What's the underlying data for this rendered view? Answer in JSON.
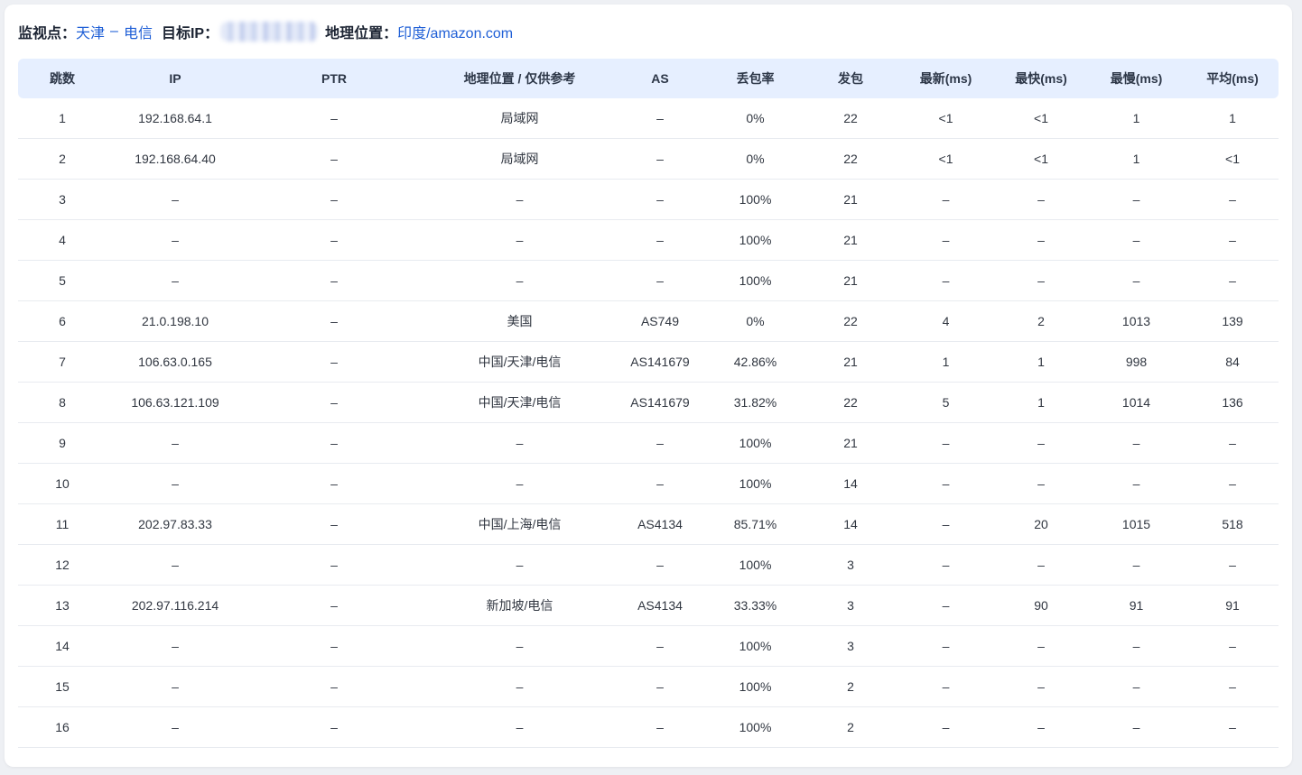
{
  "header": {
    "monitor_label": "监视点：",
    "monitor_city": "天津",
    "monitor_sep": "–",
    "monitor_isp": "电信",
    "target_label": "目标IP：",
    "geo_label": "地理位置：",
    "geo_value": "印度/amazon.com"
  },
  "colors": {
    "accent": "#1f5fd6",
    "header_bg": "#e6efff",
    "page_bg": "#eef0f4"
  },
  "table": {
    "columns": [
      "跳数",
      "IP",
      "PTR",
      "地理位置 / 仅供参考",
      "AS",
      "丢包率",
      "发包",
      "最新(ms)",
      "最快(ms)",
      "最慢(ms)",
      "平均(ms)"
    ],
    "rows": [
      [
        "1",
        "192.168.64.1",
        "–",
        "局域网",
        "–",
        "0%",
        "22",
        "<1",
        "<1",
        "1",
        "1"
      ],
      [
        "2",
        "192.168.64.40",
        "–",
        "局域网",
        "–",
        "0%",
        "22",
        "<1",
        "<1",
        "1",
        "<1"
      ],
      [
        "3",
        "–",
        "–",
        "–",
        "–",
        "100%",
        "21",
        "–",
        "–",
        "–",
        "–"
      ],
      [
        "4",
        "–",
        "–",
        "–",
        "–",
        "100%",
        "21",
        "–",
        "–",
        "–",
        "–"
      ],
      [
        "5",
        "–",
        "–",
        "–",
        "–",
        "100%",
        "21",
        "–",
        "–",
        "–",
        "–"
      ],
      [
        "6",
        "21.0.198.10",
        "–",
        "美国",
        "AS749",
        "0%",
        "22",
        "4",
        "2",
        "1013",
        "139"
      ],
      [
        "7",
        "106.63.0.165",
        "–",
        "中国/天津/电信",
        "AS141679",
        "42.86%",
        "21",
        "1",
        "1",
        "998",
        "84"
      ],
      [
        "8",
        "106.63.121.109",
        "–",
        "中国/天津/电信",
        "AS141679",
        "31.82%",
        "22",
        "5",
        "1",
        "1014",
        "136"
      ],
      [
        "9",
        "–",
        "–",
        "–",
        "–",
        "100%",
        "21",
        "–",
        "–",
        "–",
        "–"
      ],
      [
        "10",
        "–",
        "–",
        "–",
        "–",
        "100%",
        "14",
        "–",
        "–",
        "–",
        "–"
      ],
      [
        "11",
        "202.97.83.33",
        "–",
        "中国/上海/电信",
        "AS4134",
        "85.71%",
        "14",
        "–",
        "20",
        "1015",
        "518"
      ],
      [
        "12",
        "–",
        "–",
        "–",
        "–",
        "100%",
        "3",
        "–",
        "–",
        "–",
        "–"
      ],
      [
        "13",
        "202.97.116.214",
        "–",
        "新加坡/电信",
        "AS4134",
        "33.33%",
        "3",
        "–",
        "90",
        "91",
        "91"
      ],
      [
        "14",
        "–",
        "–",
        "–",
        "–",
        "100%",
        "3",
        "–",
        "–",
        "–",
        "–"
      ],
      [
        "15",
        "–",
        "–",
        "–",
        "–",
        "100%",
        "2",
        "–",
        "–",
        "–",
        "–"
      ],
      [
        "16",
        "–",
        "–",
        "–",
        "–",
        "100%",
        "2",
        "–",
        "–",
        "–",
        "–"
      ]
    ]
  }
}
